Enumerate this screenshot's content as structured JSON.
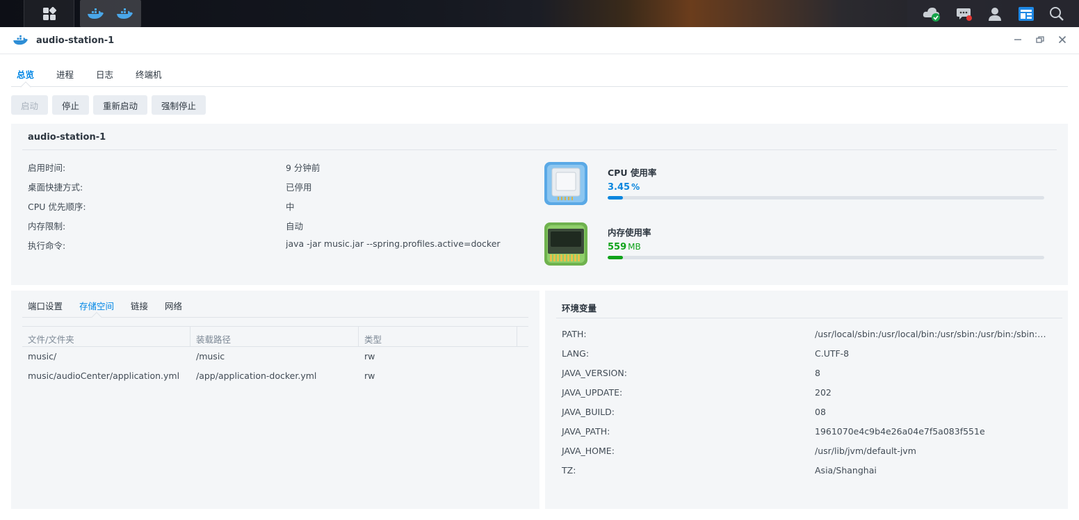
{
  "window": {
    "title": "audio-station-1"
  },
  "tabs": [
    {
      "label": "总览"
    },
    {
      "label": "进程"
    },
    {
      "label": "日志"
    },
    {
      "label": "终端机"
    }
  ],
  "actions": {
    "start": "启动",
    "stop": "停止",
    "restart": "重新启动",
    "force_stop": "强制停止"
  },
  "overview": {
    "title": "audio-station-1",
    "rows": [
      {
        "key": "启用时间:",
        "value": "9 分钟前"
      },
      {
        "key": "桌面快捷方式:",
        "value": "已停用"
      },
      {
        "key": "CPU 优先顺序:",
        "value": "中"
      },
      {
        "key": "内存限制:",
        "value": "自动"
      },
      {
        "key": "执行命令:",
        "value": "java -jar music.jar --spring.profiles.active=docker"
      }
    ],
    "cpu": {
      "label": "CPU 使用率",
      "value": "3.45",
      "unit": "%",
      "fraction": 0.0345,
      "color": "#0a86de"
    },
    "memory": {
      "label": "内存使用率",
      "value": "559",
      "unit": "MB",
      "fraction": 0.035,
      "color": "#0fa31a"
    }
  },
  "subtabs": [
    {
      "label": "端口设置"
    },
    {
      "label": "存储空间"
    },
    {
      "label": "链接"
    },
    {
      "label": "网络"
    }
  ],
  "volumes": {
    "columns": [
      "文件/文件夹",
      "装载路径",
      "类型"
    ],
    "rows": [
      {
        "path": "music/",
        "mount": "/music",
        "type": "rw"
      },
      {
        "path": "music/audioCenter/application.yml",
        "mount": "/app/application-docker.yml",
        "type": "rw"
      }
    ]
  },
  "env": {
    "title": "环境变量",
    "rows": [
      {
        "key": "PATH:",
        "value": "/usr/local/sbin:/usr/local/bin:/usr/sbin:/usr/bin:/sbin:/bin"
      },
      {
        "key": "LANG:",
        "value": "C.UTF-8"
      },
      {
        "key": "JAVA_VERSION:",
        "value": "8"
      },
      {
        "key": "JAVA_UPDATE:",
        "value": "202"
      },
      {
        "key": "JAVA_BUILD:",
        "value": "08"
      },
      {
        "key": "JAVA_PATH:",
        "value": "1961070e4c9b4e26a04e7f5a083f551e"
      },
      {
        "key": "JAVA_HOME:",
        "value": "/usr/lib/jvm/default-jvm"
      },
      {
        "key": "TZ:",
        "value": "Asia/Shanghai"
      }
    ]
  }
}
